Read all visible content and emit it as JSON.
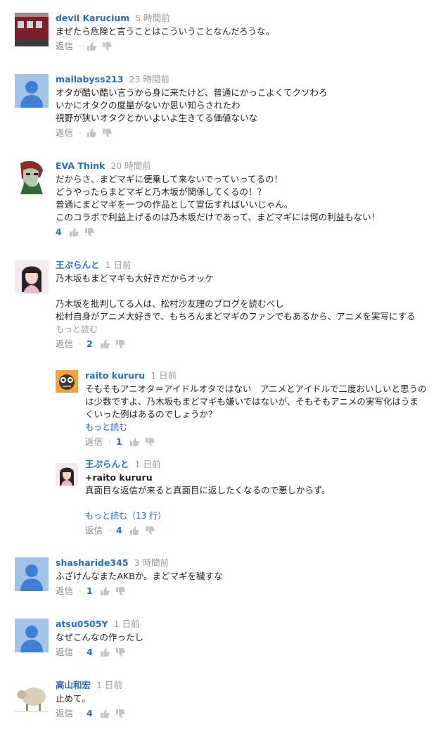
{
  "comments": [
    {
      "author": "devil Karucium",
      "time": "5 時間前",
      "lines": [
        "まぜたら危険と言うことはこういうことなんだろうな。"
      ],
      "reply": "返信",
      "likes": ""
    },
    {
      "author": "mailabyss213",
      "time": "23 時間前",
      "lines": [
        "オタが酷い酷い言うから身に来たけど、普通にかっこよくてクソわろ",
        "いかにオタクの度量がないか思い知らされたわ",
        "視野が狭いオタクとかいよいよ生きてる価値ないな"
      ],
      "reply": "返信",
      "likes": ""
    },
    {
      "author": "EVA Think",
      "time": "20 時間前",
      "lines": [
        "だからさ、まどマギに便乗して来ないでっていってるの！",
        "どうやったらまどマギと乃木坂が関係してくるの！？",
        "普通にまどマギを一つの作品として宣伝すればいいじゃん。",
        "このコラボで利益上げるのは乃木坂だけであって、まどマギには何の利益もない！"
      ],
      "reply": "",
      "likes": "4"
    },
    {
      "author": "王ぷらんと",
      "time": "1 日前",
      "lines": [
        "乃木坂もまどマギも大好きだからオッケ",
        "",
        "乃木坂を批判してる人は、松村沙友理のブログを読むべし",
        "松村自身がアニメ大好きで、もちろんまどマギのファンでもあるから、アニメを実写にする"
      ],
      "readmore": "もっと読む",
      "reply": "返信",
      "likes": "2"
    },
    {
      "author": "raito kururu",
      "time": "1 日前",
      "lines": [
        "そもそもアニオタ＝アイドルオタではない　アニメとアイドルで二度おいしいと思うの",
        "は少数ですよ、乃木坂もまどマギも嫌いではないが、そもそもアニメの実写化はうま",
        "くいった例はあるのでしょうか？"
      ],
      "readmore": "もっと読む",
      "reply": "返信",
      "likes": "1"
    },
    {
      "author": "王ぷらんと",
      "time": "1 日前",
      "mention": "+raito kururu",
      "lines": [
        "真面目な返信が来ると真面目に返したくなるので悪しからず。",
        ""
      ],
      "readmore": "もっと読む（13 行）",
      "reply": "返信",
      "likes": "4"
    },
    {
      "author": "shasharide345",
      "time": "3 時間前",
      "lines": [
        "ふざけんなまたAKBか。まどマギを穢すな"
      ],
      "reply": "返信",
      "likes": "1"
    },
    {
      "author": "atsu0505Y",
      "time": "1 日前",
      "lines": [
        "なぜこんなの作ったし"
      ],
      "reply": "返信",
      "likes": "4"
    },
    {
      "author": "高山和宏",
      "time": "1 日前",
      "lines": [
        "止めて。"
      ],
      "reply": "返信",
      "likes": "4"
    }
  ],
  "icons": {
    "like": "thumbs-up-icon",
    "dislike": "thumbs-down-icon",
    "separator": "·"
  },
  "colors": {
    "author": "#2a6bc1",
    "meta": "#999999",
    "likes": "#2a6bc1",
    "text": "#222222"
  }
}
